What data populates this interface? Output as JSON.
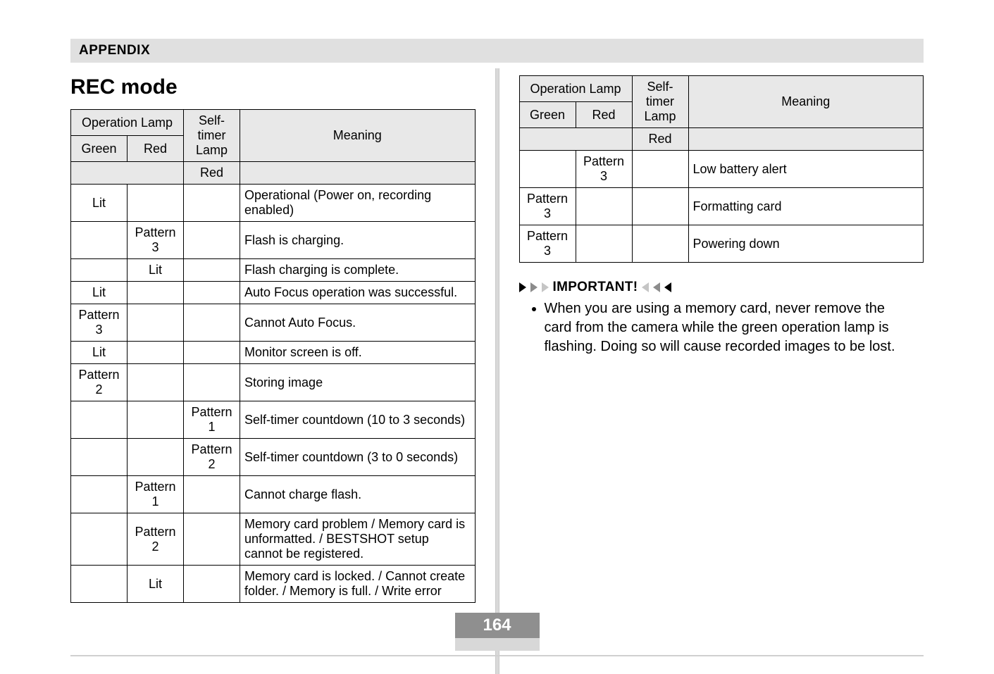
{
  "appendix_label": "APPENDIX",
  "rec_mode_title": "REC mode",
  "page_number": "164",
  "headers": {
    "operation_lamp": "Operation Lamp",
    "self_timer_lamp": "Self-timer Lamp",
    "meaning": "Meaning",
    "green": "Green",
    "red": "Red"
  },
  "table_left": [
    {
      "green": "Lit",
      "red": "",
      "st": "",
      "meaning": "Operational (Power on, recording enabled)"
    },
    {
      "green": "",
      "red": "Pattern 3",
      "st": "",
      "meaning": "Flash is charging."
    },
    {
      "green": "",
      "red": "Lit",
      "st": "",
      "meaning": "Flash charging is complete."
    },
    {
      "green": "Lit",
      "red": "",
      "st": "",
      "meaning": "Auto Focus operation was successful."
    },
    {
      "green": "Pattern 3",
      "red": "",
      "st": "",
      "meaning": "Cannot Auto Focus."
    },
    {
      "green": "Lit",
      "red": "",
      "st": "",
      "meaning": "Monitor screen is off."
    },
    {
      "green": "Pattern 2",
      "red": "",
      "st": "",
      "meaning": "Storing image"
    },
    {
      "green": "",
      "red": "",
      "st": "Pattern 1",
      "meaning": "Self-timer countdown (10 to 3 seconds)"
    },
    {
      "green": "",
      "red": "",
      "st": "Pattern 2",
      "meaning": "Self-timer countdown (3 to 0 seconds)"
    },
    {
      "green": "",
      "red": "Pattern 1",
      "st": "",
      "meaning": "Cannot charge flash."
    },
    {
      "green": "",
      "red": "Pattern 2",
      "st": "",
      "meaning": "Memory card problem / Memory card is unformatted. / BESTSHOT setup cannot be registered."
    },
    {
      "green": "",
      "red": "Lit",
      "st": "",
      "meaning": "Memory card is locked. / Cannot create folder. / Memory is full. / Write error"
    }
  ],
  "table_right": [
    {
      "green": "",
      "red": "Pattern 3",
      "st": "",
      "meaning": "Low battery alert"
    },
    {
      "green": "Pattern 3",
      "red": "",
      "st": "",
      "meaning": "Formatting card"
    },
    {
      "green": "Pattern 3",
      "red": "",
      "st": "",
      "meaning": "Powering down"
    }
  ],
  "important_label": "IMPORTANT!",
  "important_bullet": "When you are using a memory card, never remove the card from the camera while the green operation lamp is flashing. Doing so will cause recorded images to be lost."
}
